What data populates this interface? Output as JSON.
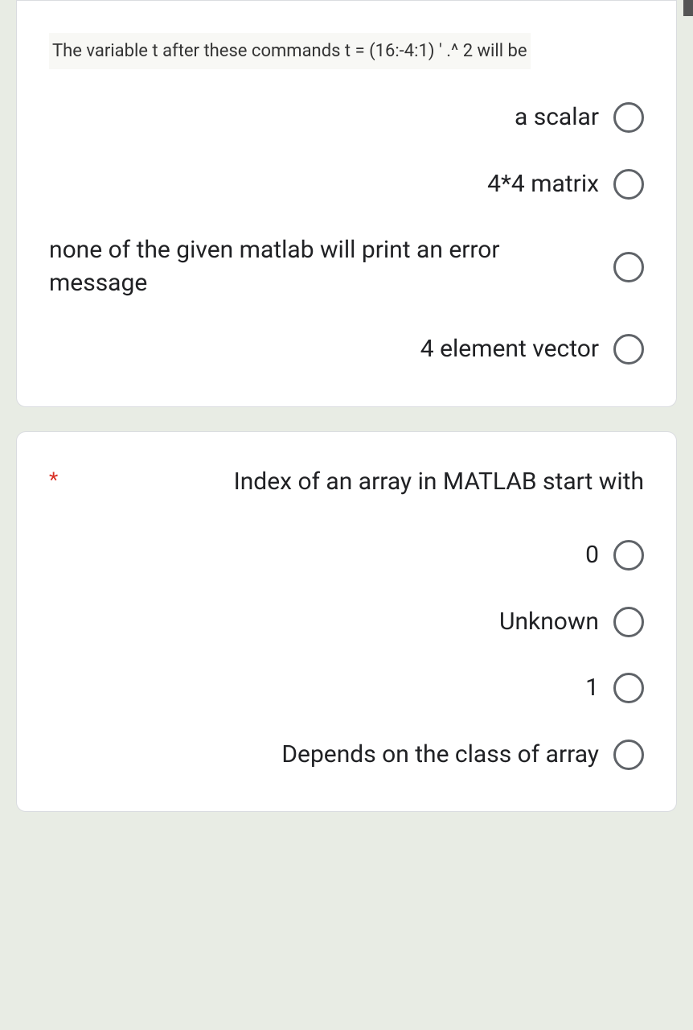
{
  "question1": {
    "prompt": "The variable t after these commands t = (16:-4:1) ' .^ 2 will be",
    "options": [
      "a scalar",
      "4*4 matrix",
      "none of the given matlab will print an error message",
      "4 element vector"
    ]
  },
  "question2": {
    "required_mark": "*",
    "prompt": "Index of an array in MATLAB start with",
    "options": [
      "0",
      "Unknown",
      "1",
      "Depends on the class of array"
    ]
  }
}
